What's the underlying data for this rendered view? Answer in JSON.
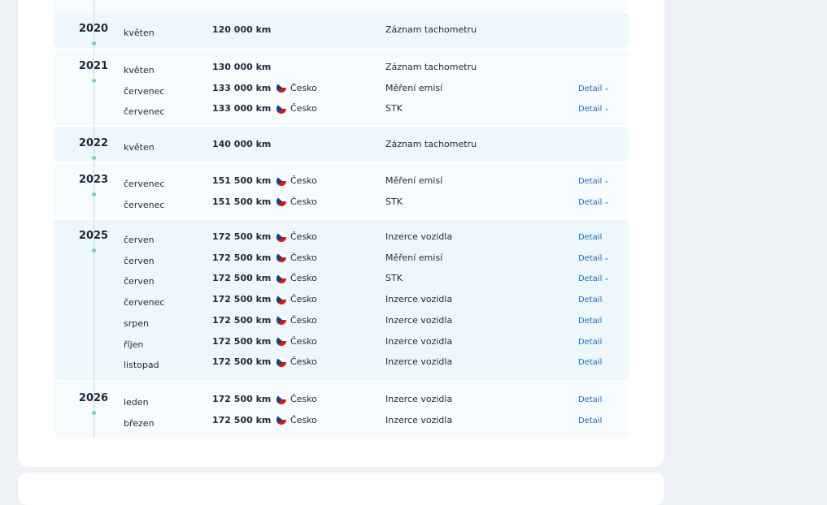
{
  "groups": [
    {
      "year": "2020",
      "rows": [
        {
          "month": "květen",
          "km": "120 000 km",
          "country": "",
          "event": "Záznam tachometru",
          "detail": "",
          "expandable": false
        }
      ]
    },
    {
      "year": "2021",
      "rows": [
        {
          "month": "květen",
          "km": "130 000 km",
          "country": "",
          "event": "Záznam tachometru",
          "detail": "",
          "expandable": false
        },
        {
          "month": "červenec",
          "km": "133 000 km",
          "country": "Česko",
          "event": "Měření emisí",
          "detail": "Detail",
          "expandable": true
        },
        {
          "month": "červenec",
          "km": "133 000 km",
          "country": "Česko",
          "event": "STK",
          "detail": "Detail",
          "expandable": true
        }
      ]
    },
    {
      "year": "2022",
      "rows": [
        {
          "month": "květen",
          "km": "140 000 km",
          "country": "",
          "event": "Záznam tachometru",
          "detail": "",
          "expandable": false
        }
      ]
    },
    {
      "year": "2023",
      "rows": [
        {
          "month": "červenec",
          "km": "151 500 km",
          "country": "Česko",
          "event": "Měření emisí",
          "detail": "Detail",
          "expandable": true
        },
        {
          "month": "červenec",
          "km": "151 500 km",
          "country": "Česko",
          "event": "STK",
          "detail": "Detail",
          "expandable": true
        }
      ]
    },
    {
      "year": "2025",
      "rows": [
        {
          "month": "červen",
          "km": "172 500 km",
          "country": "Česko",
          "event": "Inzerce vozidla",
          "detail": "Detail",
          "expandable": false
        },
        {
          "month": "červen",
          "km": "172 500 km",
          "country": "Česko",
          "event": "Měření emisí",
          "detail": "Detail",
          "expandable": true
        },
        {
          "month": "červen",
          "km": "172 500 km",
          "country": "Česko",
          "event": "STK",
          "detail": "Detail",
          "expandable": true
        },
        {
          "month": "červenec",
          "km": "172 500 km",
          "country": "Česko",
          "event": "Inzerce vozidla",
          "detail": "Detail",
          "expandable": false
        },
        {
          "month": "srpen",
          "km": "172 500 km",
          "country": "Česko",
          "event": "Inzerce vozidla",
          "detail": "Detail",
          "expandable": false
        },
        {
          "month": "říjen",
          "km": "172 500 km",
          "country": "Česko",
          "event": "Inzerce vozidla",
          "detail": "Detail",
          "expandable": false
        },
        {
          "month": "listopad",
          "km": "172 500 km",
          "country": "Česko",
          "event": "Inzerce vozidla",
          "detail": "Detail",
          "expandable": false
        }
      ]
    },
    {
      "year": "2026",
      "rows": [
        {
          "month": "leden",
          "km": "172 500 km",
          "country": "Česko",
          "event": "Inzerce vozidla",
          "detail": "Detail",
          "expandable": false
        },
        {
          "month": "březen",
          "km": "172 500 km",
          "country": "Česko",
          "event": "Inzerce vozidla",
          "detail": "Detail",
          "expandable": false
        }
      ]
    }
  ]
}
